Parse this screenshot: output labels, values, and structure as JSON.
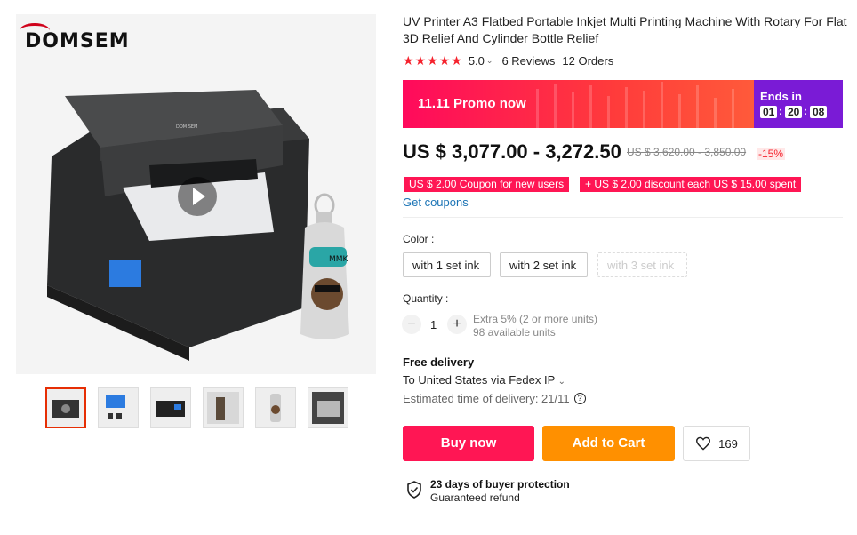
{
  "brand": "DOMSEM",
  "title": "UV Printer A3 Flatbed Portable Inkjet Multi Printing Machine With Rotary For Flat 3D Relief And Cylinder Bottle Relief",
  "rating": {
    "value": "5.0",
    "stars": 5,
    "reviews": "6 Reviews",
    "orders": "12 Orders"
  },
  "promo": {
    "text": "11.11 Promo now",
    "ends_label": "Ends in",
    "hours": "01",
    "minutes": "20",
    "seconds": "08"
  },
  "price": {
    "current": "US $ 3,077.00 - 3,272.50",
    "original": "US $ 3,620.00 - 3,850.00",
    "discount": "-15%"
  },
  "coupons": [
    "US $ 2.00 Coupon for new users",
    "+ US $ 2.00 discount each US $ 15.00 spent"
  ],
  "get_coupons": "Get coupons",
  "color": {
    "label": "Color :",
    "options": [
      "with 1 set ink",
      "with 2 set ink",
      "with 3 set ink"
    ]
  },
  "quantity": {
    "label": "Quantity :",
    "value": "1",
    "note": "Extra 5% (2 or more units)",
    "available": "98 available units"
  },
  "delivery": {
    "title": "Free delivery",
    "route": "To United States via Fedex IP",
    "estimate": "Estimated time of delivery: 21/11"
  },
  "buttons": {
    "buy": "Buy now",
    "cart": "Add to Cart",
    "wishes": "169"
  },
  "protection": {
    "title": "23 days of buyer protection",
    "subtitle": "Guaranteed refund"
  },
  "image_labels": {
    "printer": "DOM SEM",
    "bottle": "MMK"
  },
  "colors": {
    "accent": "#f5222d",
    "cart": "#ff9000",
    "buy": "#ff1654",
    "link": "#1a73b5",
    "ends": "#7a1bd6"
  }
}
